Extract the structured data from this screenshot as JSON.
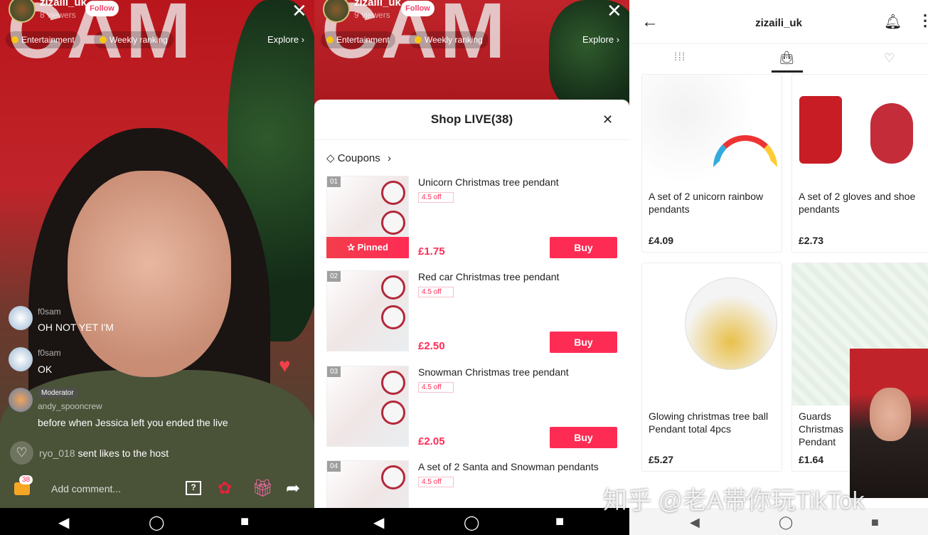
{
  "live": {
    "username": "zizaili_uk",
    "viewers": "8 viewers",
    "follow_label": "Follow",
    "chips": [
      "Entertainment",
      "Weekly ranking"
    ],
    "explore_label": "Explore ›",
    "comments": [
      {
        "user": "f0sam",
        "text": "OH NOT YET I'M"
      },
      {
        "user": "f0sam",
        "text": "OK"
      },
      {
        "badge": "Moderator",
        "user": "andy_spooncrew",
        "text": "before when Jessica left you ended the live"
      }
    ],
    "like_event": {
      "user": "ryo_018",
      "text": "sent likes to the host"
    },
    "cart_count": "38",
    "comment_placeholder": "Add comment...",
    "question_icon": "?"
  },
  "live2": {
    "username": "zizaili_uk",
    "viewers": "9 viewers",
    "follow_label": "Follow",
    "chips": [
      "Entertainment",
      "Weekly ranking"
    ],
    "explore_label": "Explore ›"
  },
  "shop": {
    "title": "Shop LIVE(38)",
    "coupons_label": "Coupons",
    "pinned_label": "Pinned",
    "buy_label": "Buy",
    "products": [
      {
        "num": "01",
        "name": "Unicorn Christmas tree pendant",
        "discount": "4.5 off",
        "price": "£1.75"
      },
      {
        "num": "02",
        "name": "Red car Christmas tree pendant",
        "discount": "4.5 off",
        "price": "£2.50"
      },
      {
        "num": "03",
        "name": "Snowman Christmas tree pendant",
        "discount": "4.5 off",
        "price": "£2.05"
      },
      {
        "num": "04",
        "name": "A set of 2 Santa and Snowman pendants",
        "discount": "4.5 off",
        "price": ""
      }
    ]
  },
  "store": {
    "title": "zizaili_uk",
    "products": [
      {
        "name": "A set of 2 unicorn rainbow pendants",
        "price": "£4.09"
      },
      {
        "name": "A set of 2 gloves and shoe pendants",
        "price": "£2.73"
      },
      {
        "name": "Glowing christmas tree ball Pendant total 4pcs",
        "price": "£5.27"
      },
      {
        "name": "Guards Christmas Pendant",
        "price": "£1.64"
      }
    ]
  },
  "watermark": "知乎 @老A带你玩TikTok",
  "colors": {
    "accent": "#fe2c55",
    "live_bg": "#c0242a"
  }
}
